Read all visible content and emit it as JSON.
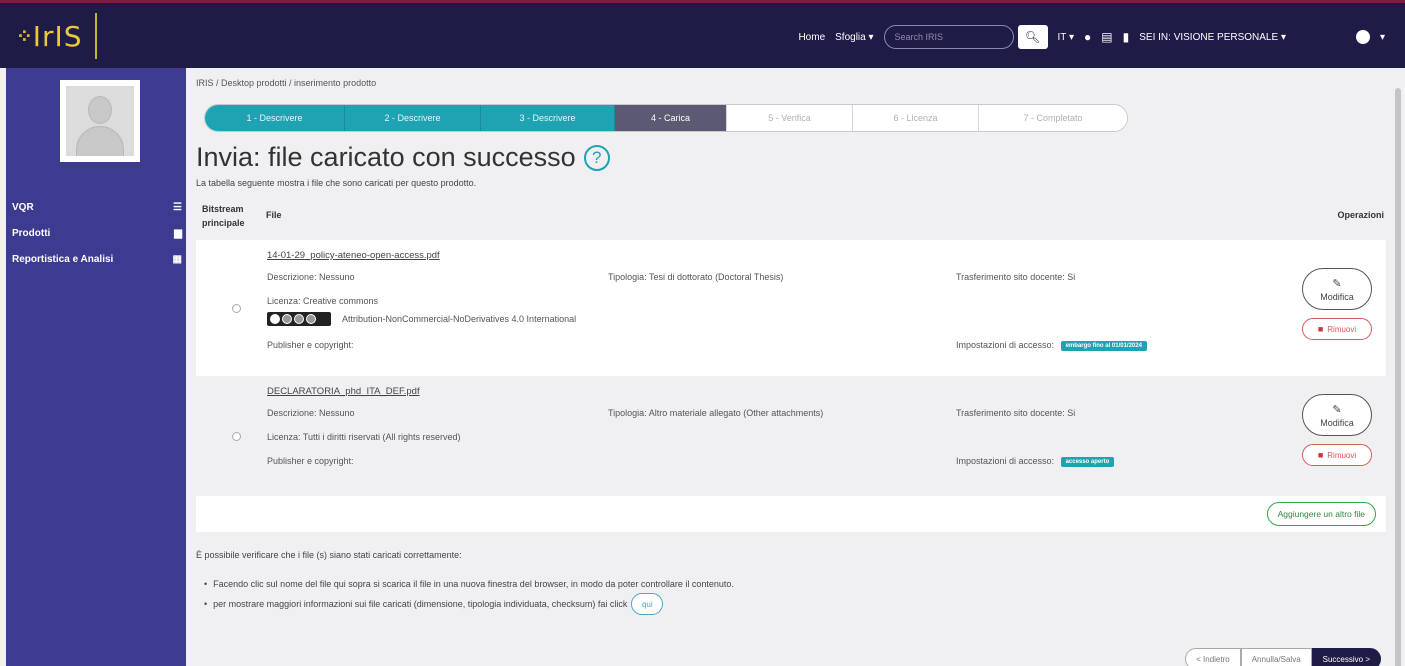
{
  "navbar": {
    "logo_text": "IrIS",
    "home": "Home",
    "browse": "Sfoglia ▾",
    "search_placeholder": "Search IRIS",
    "language": "IT ▾",
    "view_mode": "SEI IN: VISIONE PERSONALE ▾"
  },
  "sidebar": {
    "items": [
      {
        "label": "VQR",
        "icon": "list-icon"
      },
      {
        "label": "Prodotti",
        "icon": "document-icon"
      },
      {
        "label": "Reportistica e Analisi",
        "icon": "table-icon"
      }
    ]
  },
  "main": {
    "breadcrumb": "IRIS  /  Desktop prodotti  /  inserimento prodotto",
    "steps": [
      {
        "label": "1 - Descrivere",
        "state": "done"
      },
      {
        "label": "2 - Descrivere",
        "state": "done"
      },
      {
        "label": "3 - Descrivere",
        "state": "done"
      },
      {
        "label": "4 - Carica",
        "state": "active"
      },
      {
        "label": "5 - Verifica",
        "state": "todo"
      },
      {
        "label": "6 - Licenza",
        "state": "todo"
      },
      {
        "label": "7 - Completato",
        "state": "todo"
      }
    ],
    "title": "Invia: file caricato con successo",
    "subtitle": "La tabella seguente mostra i file che sono caricati per questo prodotto.",
    "table": {
      "col_bitstream_1": "Bitstream",
      "col_bitstream_2": "principale",
      "col_file": "File",
      "col_operations": "Operazioni"
    },
    "files": [
      {
        "name": "14-01-29_policy-ateneo-open-access.pdf",
        "description": "Descrizione: Nessuno",
        "type": "Tipologia: Tesi di dottorato (Doctoral Thesis)",
        "transfer": "Trasferimento sito docente: Si",
        "license": "Licenza: Creative commons",
        "license_detail": "Attribution-NonCommercial-NoDerivatives 4.0 International",
        "publisher": "Publisher e copyright:",
        "access_label": "Impostazioni di accesso:",
        "access_tag": "embargo fino al 01/01/2024"
      },
      {
        "name": "DECLARATORIA_phd_ITA_DEF.pdf",
        "description": "Descrizione: Nessuno",
        "type": "Tipologia: Altro materiale allegato (Other attachments)",
        "transfer": "Trasferimento sito docente: Si",
        "license": "Licenza: Tutti i diritti riservati (All rights reserved)",
        "publisher": "Publisher e copyright:",
        "access_label": "Impostazioni di accesso:",
        "access_tag": "accesso aperto"
      }
    ],
    "edit_label": "Modifica",
    "remove_label": "Rimuovi",
    "add_file_label": "Aggiungere un altro file",
    "info_text": "È possibile verificare che i file (s) siano stati caricati correttamente:",
    "bullet_1": "Facendo clic sul nome del file qui sopra si scarica il file in una nuova finestra del browser, in modo da poter controllare il contenuto.",
    "bullet_2": "per mostrare maggiori informazioni sui file caricati (dimensione, tipologia individuata, checksum) fai click",
    "qui_label": "qui",
    "buttons": {
      "back": "< Indietro",
      "cancel": "Annulla/Salva",
      "next": "Successivo >"
    }
  }
}
